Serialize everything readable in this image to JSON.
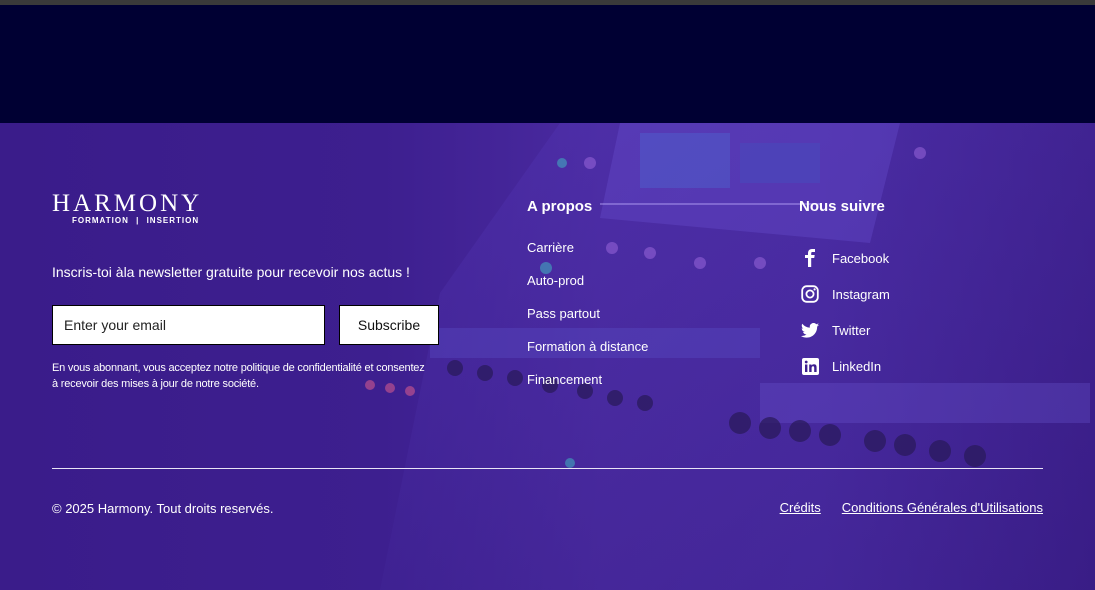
{
  "brand": {
    "name": "HARMONY",
    "tagline_left": "FORMATION",
    "tagline_sep": "|",
    "tagline_right": "INSERTION"
  },
  "newsletter": {
    "text": "Inscris-toi àla newsletter gratuite pour recevoir nos actus !",
    "email_placeholder": "Enter your email",
    "subscribe_label": "Subscribe",
    "legal_line1": "En vous abonnant, vous acceptez notre politique de confidentialité et consentez",
    "legal_line2": "à recevoir des mises à jour de notre société."
  },
  "about": {
    "title": "A propos",
    "links": [
      "Carrière",
      "Auto-prod",
      "Pass partout",
      "Formation à distance",
      "Financement"
    ]
  },
  "follow": {
    "title": "Nous suivre",
    "links": [
      {
        "label": "Facebook",
        "icon": "facebook-icon"
      },
      {
        "label": "Instagram",
        "icon": "instagram-icon"
      },
      {
        "label": "Twitter",
        "icon": "twitter-icon"
      },
      {
        "label": "LinkedIn",
        "icon": "linkedin-icon"
      }
    ]
  },
  "bottom": {
    "copyright": "© 2025 Harmony. Tout droits reservés.",
    "credits": "Crédits",
    "terms": "Conditions Générales d'Utilisations"
  },
  "colors": {
    "header_band": "#000033",
    "footer_purple": "#3d1f8f",
    "text": "#ffffff"
  }
}
